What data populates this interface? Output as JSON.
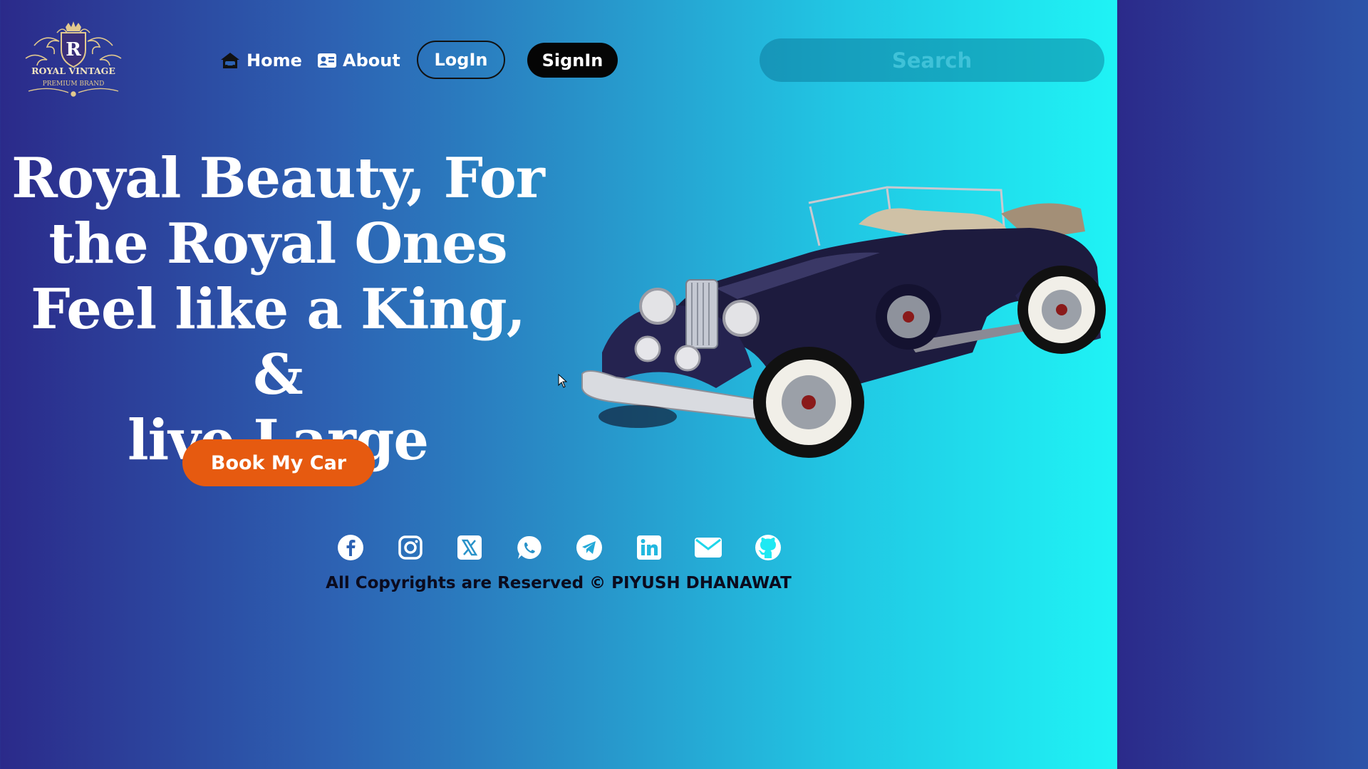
{
  "brand": {
    "logo_letter": "R",
    "name": "ROYAL VINTAGE",
    "tagline": "PREMIUM BRAND"
  },
  "nav": {
    "home": {
      "label": "Home",
      "icon": "house-car-icon"
    },
    "about": {
      "label": "About",
      "icon": "id-card-icon"
    },
    "login_label": "LogIn",
    "signin_label": "SignIn",
    "search_placeholder": "Search"
  },
  "hero": {
    "title_lines": [
      "Royal Beauty, For",
      "the Royal Ones",
      "Feel like a King, &",
      "live Large"
    ],
    "cta_label": "Book My Car",
    "image": "vintage-convertible-car"
  },
  "footer": {
    "social_icons": [
      "facebook-icon",
      "instagram-icon",
      "x-twitter-icon",
      "whatsapp-icon",
      "telegram-icon",
      "linkedin-icon",
      "email-icon",
      "github-icon"
    ],
    "copyright": "All Copyrights are Reserved © PIYUSH DHANAWAT"
  },
  "colors": {
    "gradient_start": "#2b2a8a",
    "gradient_end": "#1ff3f5",
    "cta": "#e65a10",
    "signin_bg": "#050505"
  }
}
